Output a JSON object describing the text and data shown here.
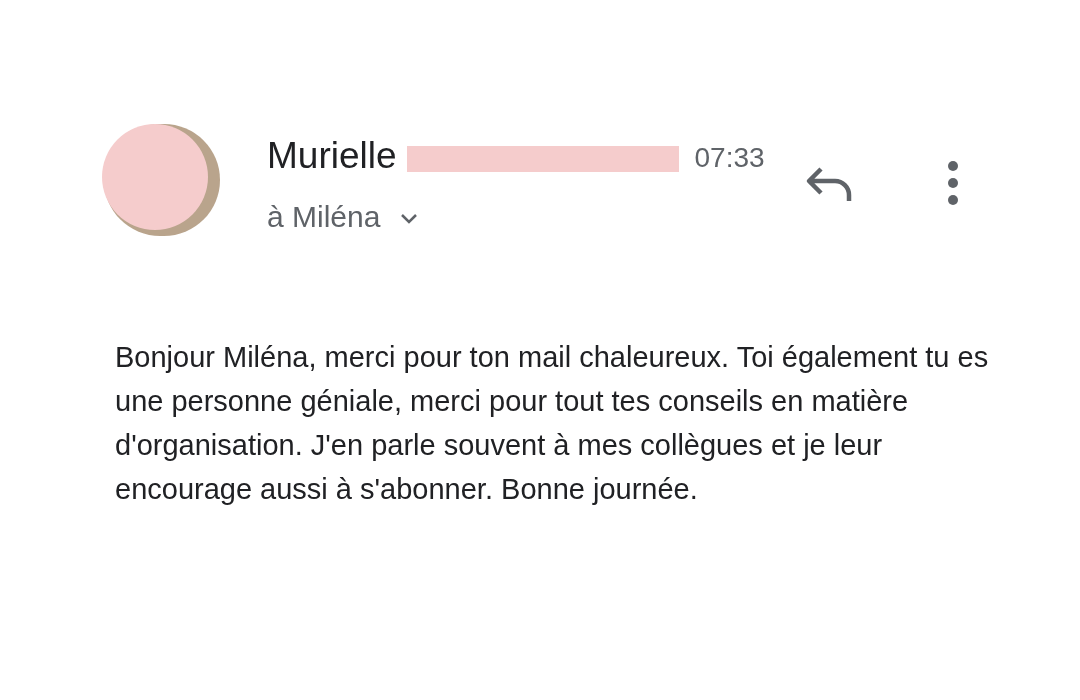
{
  "message": {
    "sender": {
      "name": "Murielle",
      "redacted": true
    },
    "time": "07:33",
    "recipient": "à Miléna",
    "body": "Bonjour Miléna, merci pour ton mail chaleureux. Toi également tu es une personne géniale, merci pour tout tes conseils en matière d'organisation. J'en parle souvent à mes collègues et je leur encourage aussi à s'abonner. Bonne journée."
  }
}
